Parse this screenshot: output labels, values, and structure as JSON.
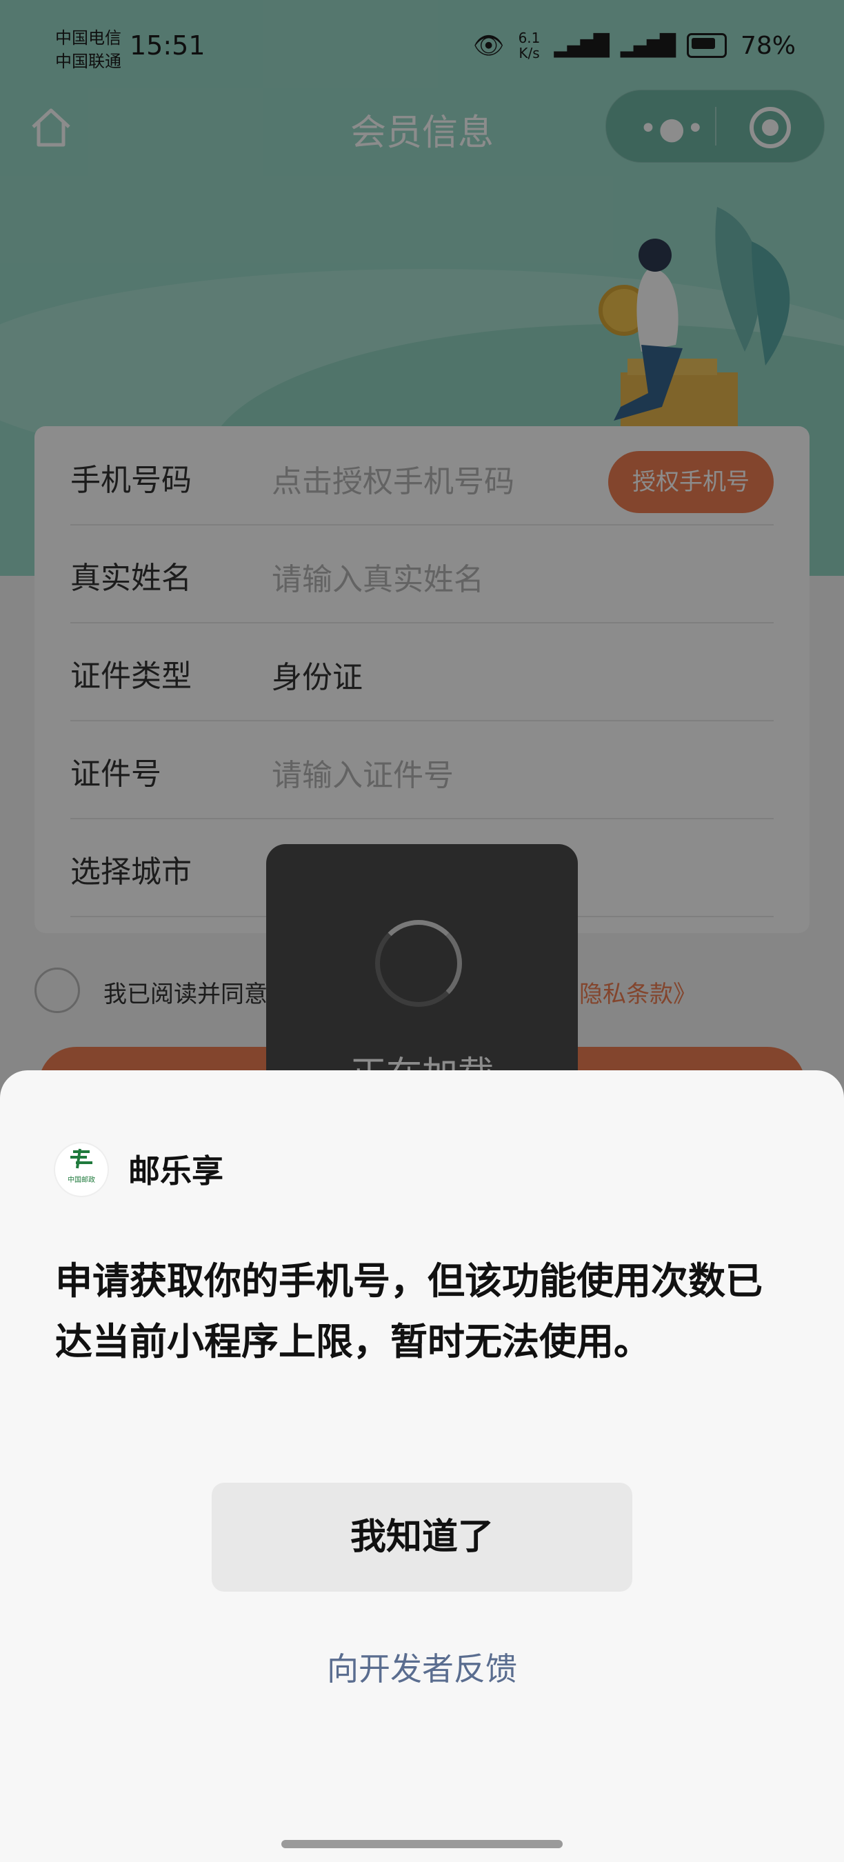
{
  "status_bar": {
    "carrier1": "中国电信",
    "carrier2": "中国联通",
    "time": "15:51",
    "net_speed_value": "6.1",
    "net_speed_unit": "K/s",
    "battery": "78%"
  },
  "navbar": {
    "title": "会员信息"
  },
  "form": {
    "phone_label": "手机号码",
    "phone_placeholder": "点击授权手机号码",
    "authorize_button": "授权手机号",
    "name_label": "真实姓名",
    "name_placeholder": "请输入真实姓名",
    "id_type_label": "证件类型",
    "id_type_value": "身份证",
    "id_number_label": "证件号",
    "id_number_placeholder": "请输入证件号",
    "city_label": "选择城市"
  },
  "agreement": {
    "text_start": "我已阅读并同意",
    "privacy_link": "隐私条款》"
  },
  "loading": {
    "text": "正在加载"
  },
  "sheet": {
    "app_name": "邮乐享",
    "logo_text": "中国邮政",
    "message": "申请获取你的手机号，但该功能使用次数已达当前小程序上限，暂时无法使用。",
    "ok_button": "我知道了",
    "feedback_link": "向开发者反馈"
  },
  "colors": {
    "hero": "#9ad9c8",
    "accent": "#ee7f52",
    "link": "#5a6d8f"
  }
}
